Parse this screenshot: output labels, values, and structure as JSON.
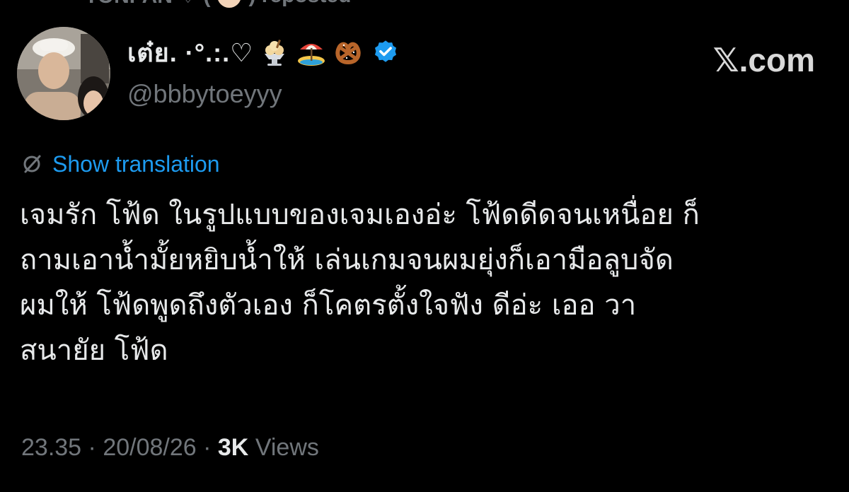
{
  "repost": {
    "label": "TONPAN ♡ (",
    "suffix": ") reposted"
  },
  "author": {
    "display_name": "เต๋ย.  ·°.:.♡",
    "emojis": [
      "ice-cream-icon",
      "beach-umbrella-icon",
      "pretzel-icon"
    ],
    "verified": true,
    "handle": "@bbbytoeyyy"
  },
  "brand": {
    "text": "𝕏.com"
  },
  "translation": {
    "label": "Show translation"
  },
  "tweet": {
    "lines": [
      "เจมรัก โฟ้ด ในรูปแบบของเจมเองอ่ะ โฟ้ดดีดจนเหนื่อย ก็",
      "ถามเอาน้ำมั้ยหยิบน้ำให้ เล่นเกมจนผมยุ่งก็เอามือลูบจัด",
      "ผมให้ โฟ้ดพูดถึงตัวเอง ก็โคตรตั้งใจฟัง ดีอ่ะ เออ วา",
      "สนายัย โฟ้ด"
    ]
  },
  "meta": {
    "time": "23.35",
    "separator": " · ",
    "date": "20/08/26",
    "views_count": "3K",
    "views_label": "Views"
  },
  "colors": {
    "background": "#000000",
    "text_primary": "#e7e9ea",
    "text_secondary": "#71767b",
    "link": "#1d9bf0",
    "verified": "#1d9bf0"
  }
}
